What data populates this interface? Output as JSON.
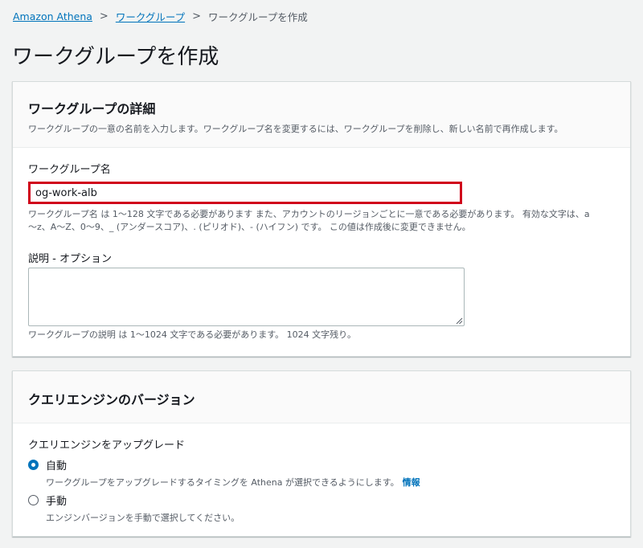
{
  "breadcrumb": {
    "items": [
      "Amazon Athena",
      "ワークグループ"
    ],
    "separator": ">",
    "current": "ワークグループを作成"
  },
  "page": {
    "title": "ワークグループを作成"
  },
  "details_panel": {
    "title": "ワークグループの詳細",
    "description": "ワークグループの一意の名前を入力します。ワークグループ名を変更するには、ワークグループを削除し、新しい名前で再作成します。",
    "name_field": {
      "label": "ワークグループ名",
      "value": "og-work-alb",
      "help_line1": "ワークグループ名 は 1～128 文字である必要があります また、アカウントのリージョンごとに一意である必要があります。 有効な文字は、a",
      "help_line2": "～z、A～Z、0～9、_ (アンダースコア)、. (ピリオド)、- (ハイフン) です。 この値は作成後に変更できません。"
    },
    "description_field": {
      "label": "説明 - オプション",
      "value": "",
      "help": "ワークグループの説明 は 1～1024 文字である必要があります。 1024 文字残り。"
    }
  },
  "engine_panel": {
    "title": "クエリエンジンのバージョン",
    "upgrade_label": "クエリエンジンをアップグレード",
    "options": [
      {
        "label": "自動",
        "description": "ワークグループをアップグレードするタイミングを Athena が選択できるようにします。",
        "link": "情報",
        "checked": true
      },
      {
        "label": "手動",
        "description": "エンジンバージョンを手動で選択してください。",
        "checked": false
      }
    ]
  },
  "colors": {
    "link": "#0073bb",
    "highlight_border": "#d0021b",
    "background": "#f2f3f3"
  }
}
